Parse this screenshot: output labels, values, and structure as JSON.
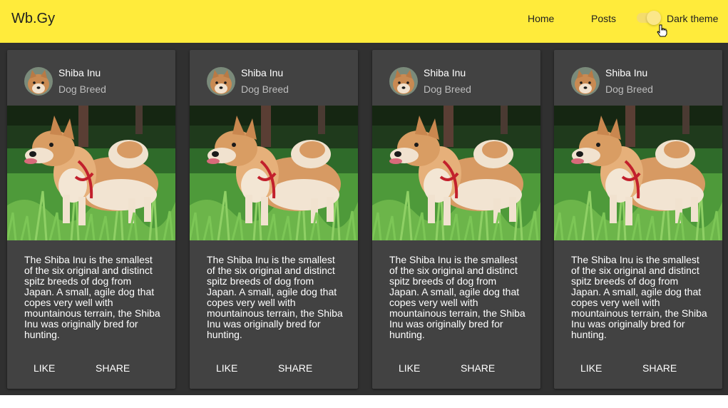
{
  "header": {
    "brand": "Wb.Gy",
    "nav": {
      "home": "Home",
      "posts": "Posts"
    },
    "theme_toggle": {
      "label": "Dark theme",
      "on": true
    }
  },
  "colors": {
    "appbar": "#ffeb3b",
    "background": "#303030",
    "card": "#424242"
  },
  "cards": [
    {
      "title": "Shiba Inu",
      "subtitle": "Dog Breed",
      "text": "The Shiba Inu is the smallest of the six original and distinct spitz breeds of dog from Japan. A small, agile dog that copes very well with mountainous terrain, the Shiba Inu was originally bred for hunting.",
      "like": "LIKE",
      "share": "SHARE"
    },
    {
      "title": "Shiba Inu",
      "subtitle": "Dog Breed",
      "text": "The Shiba Inu is the smallest of the six original and distinct spitz breeds of dog from Japan. A small, agile dog that copes very well with mountainous terrain, the Shiba Inu was originally bred for hunting.",
      "like": "LIKE",
      "share": "SHARE"
    },
    {
      "title": "Shiba Inu",
      "subtitle": "Dog Breed",
      "text": "The Shiba Inu is the smallest of the six original and distinct spitz breeds of dog from Japan. A small, agile dog that copes very well with mountainous terrain, the Shiba Inu was originally bred for hunting.",
      "like": "LIKE",
      "share": "SHARE"
    },
    {
      "title": "Shiba Inu",
      "subtitle": "Dog Breed",
      "text": "The Shiba Inu is the smallest of the six original and distinct spitz breeds of dog from Japan. A small, agile dog that copes very well with mountainous terrain, the Shiba Inu was originally bred for hunting.",
      "like": "LIKE",
      "share": "SHARE"
    }
  ]
}
